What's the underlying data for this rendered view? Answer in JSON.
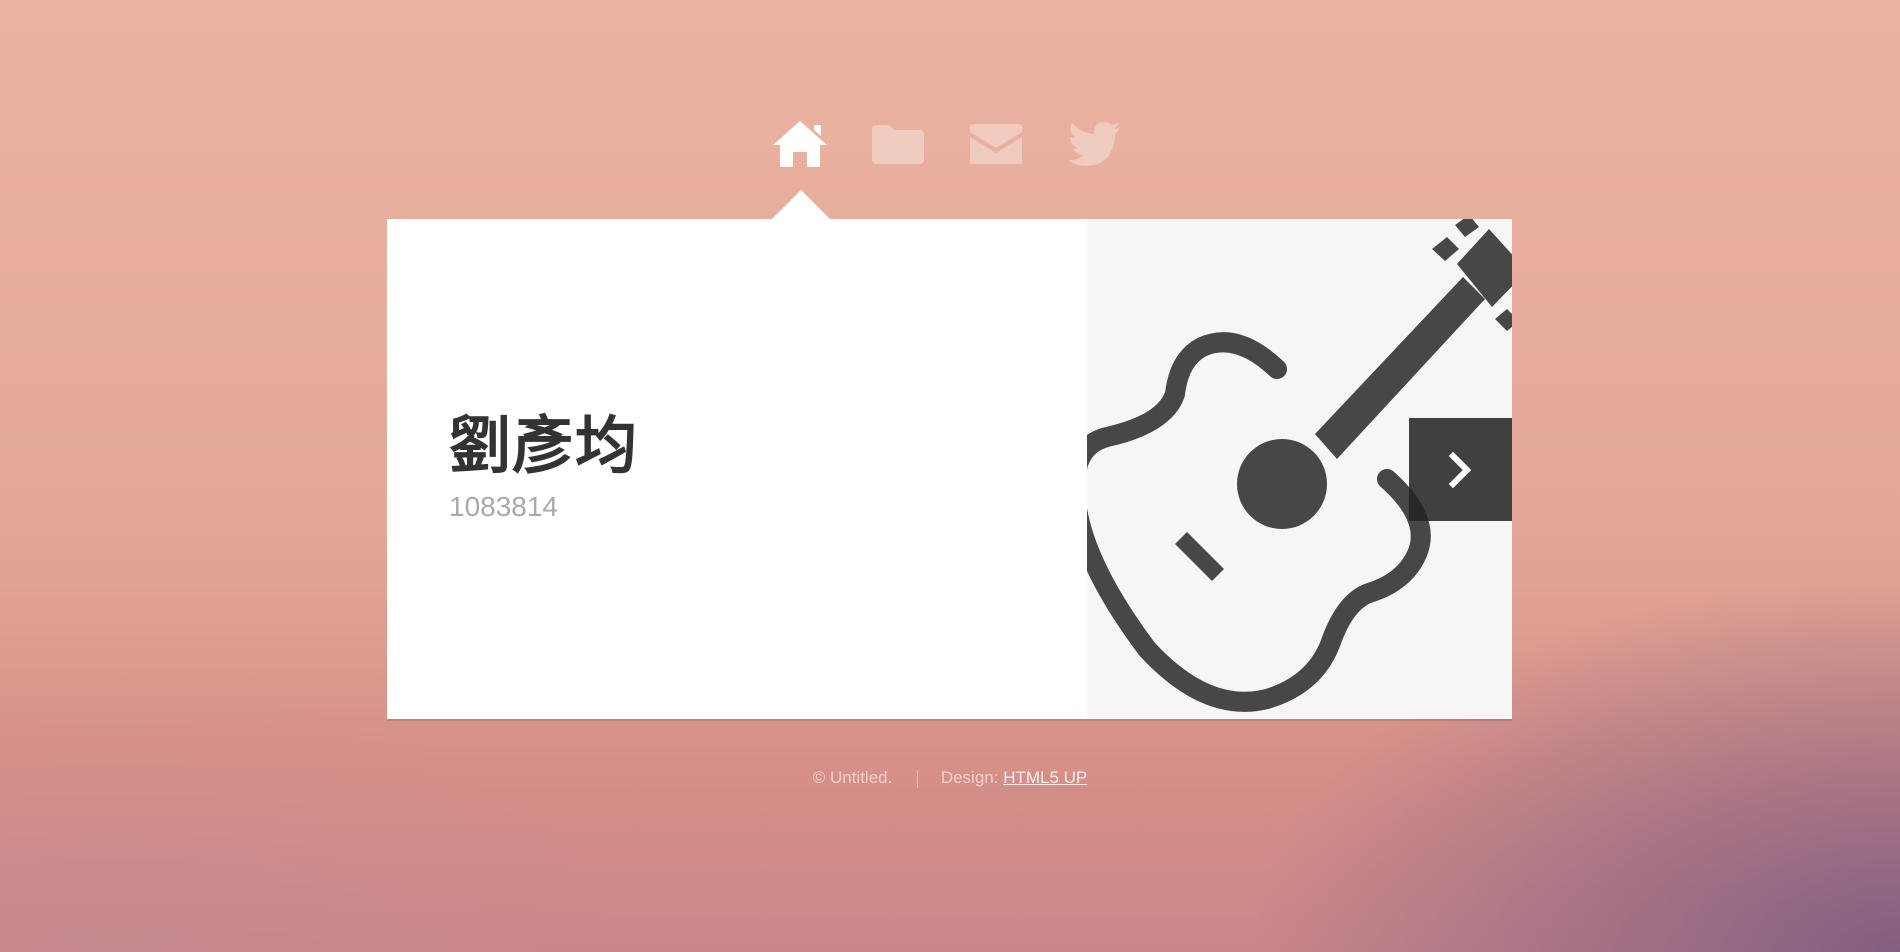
{
  "nav": {
    "items": [
      {
        "icon": "home-icon",
        "active": true
      },
      {
        "icon": "folder-icon",
        "active": false
      },
      {
        "icon": "envelope-icon",
        "active": false
      },
      {
        "icon": "twitter-icon",
        "active": false
      }
    ]
  },
  "intro": {
    "name": "劉彥均",
    "subtitle": "1083814"
  },
  "feature": {
    "image_icon": "guitar-icon",
    "next_icon": "chevron-right-icon"
  },
  "footer": {
    "copyright": "© Untitled.",
    "design_label": "Design:",
    "design_link": "HTML5 UP"
  },
  "colors": {
    "accent": "#ffffff",
    "text_dark": "#333333",
    "text_muted": "#a9a9a9",
    "bg_top": "#ecb2a1",
    "bg_bottom": "#8c6a86"
  }
}
